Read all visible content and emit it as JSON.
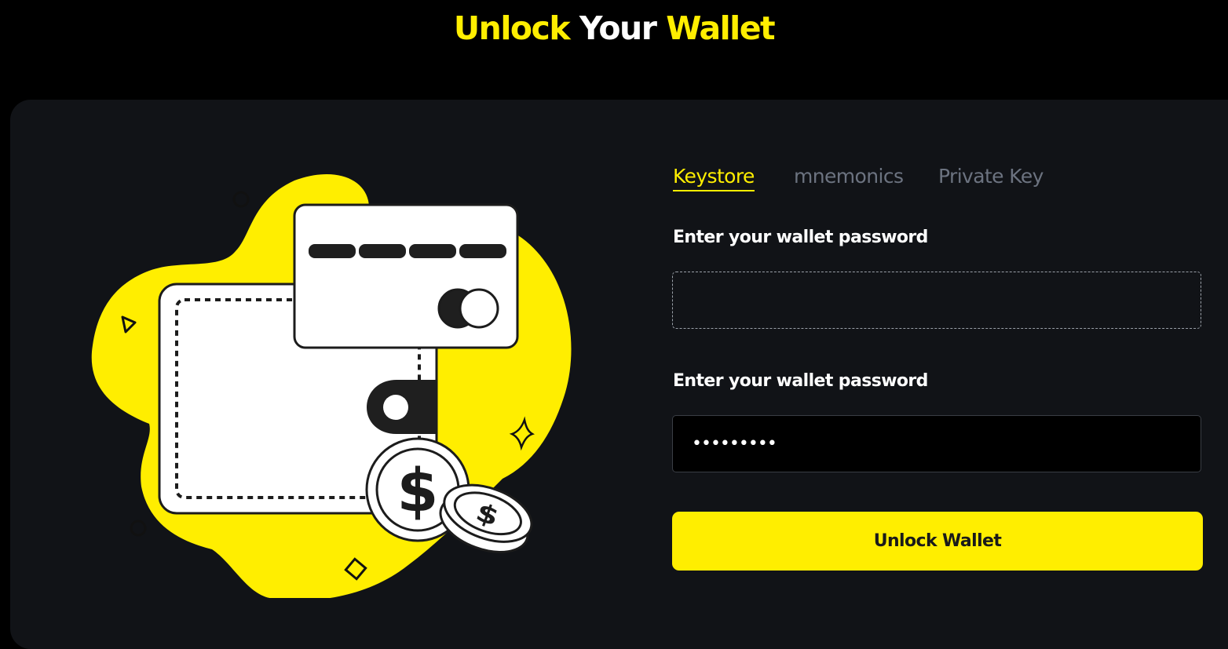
{
  "header": {
    "title_part1": "Unlock",
    "title_part2": "Your",
    "title_part3": "Wallet"
  },
  "tabs": [
    {
      "label": "Keystore",
      "active": true
    },
    {
      "label": "mnemonics",
      "active": false
    },
    {
      "label": "Private Key",
      "active": false
    }
  ],
  "form": {
    "field1_label": "Enter your wallet password",
    "field1_value": "",
    "field2_label": "Enter your wallet password",
    "field2_value": "•••••••••",
    "submit_label": "Unlock Wallet"
  },
  "colors": {
    "accent": "#FFEE00",
    "background": "#000000",
    "card": "#111317",
    "muted_tab": "#6C7380"
  },
  "illustration": {
    "icons": [
      "wallet-icon",
      "credit-card-icon",
      "dollar-coin-icon",
      "sparkle-icon"
    ],
    "coin_symbol": "$"
  }
}
